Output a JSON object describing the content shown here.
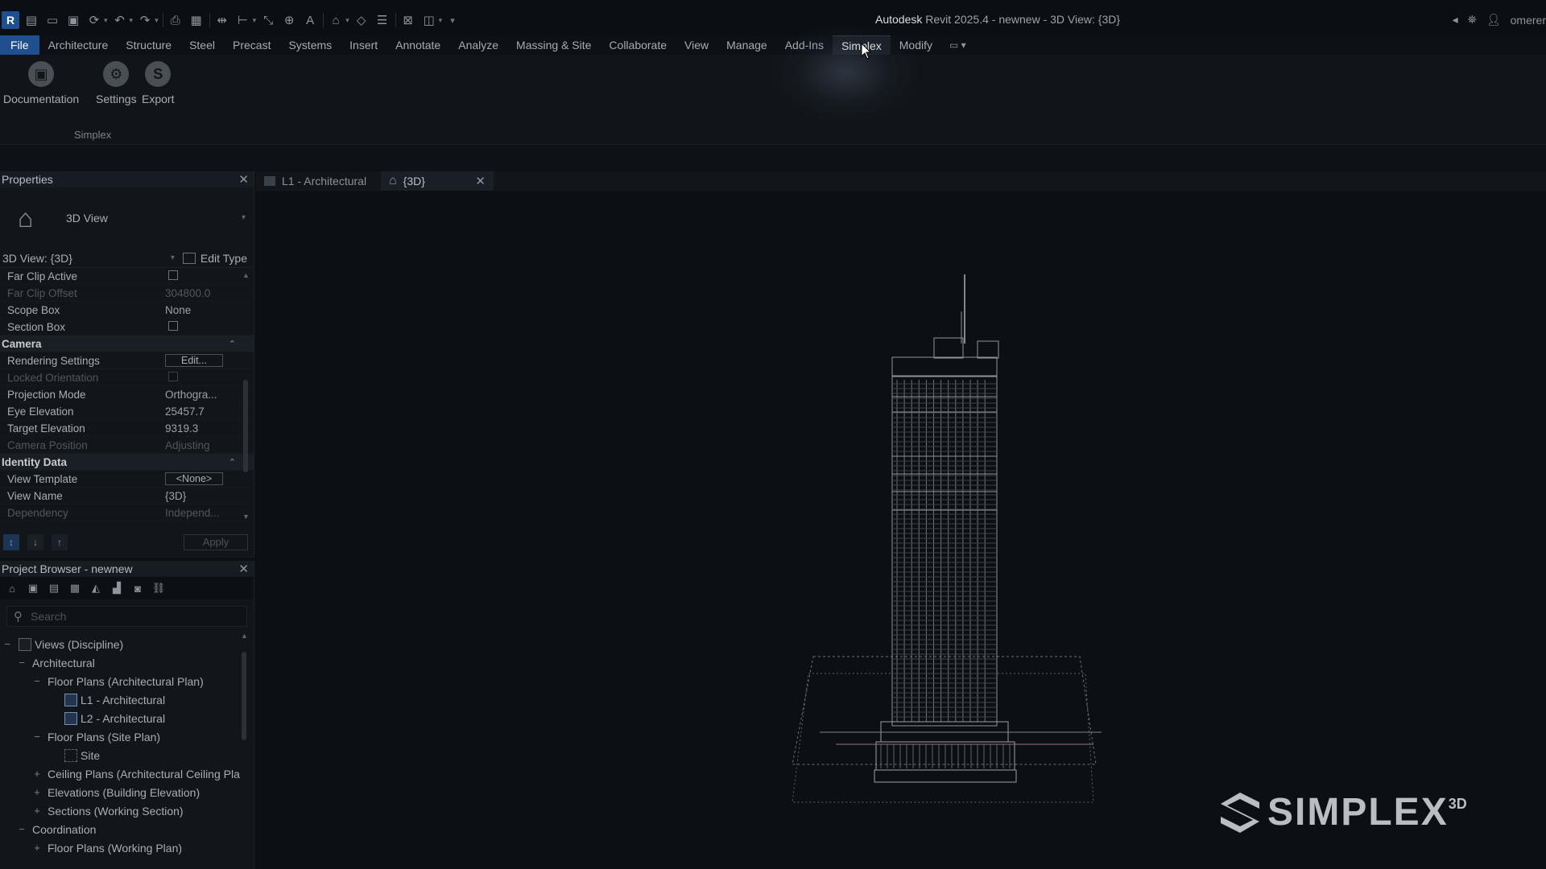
{
  "app": {
    "title_app": "Autodesk",
    "title_rest": " Revit 2025.4 - newnew - 3D View: {3D}",
    "logo_letter": "R",
    "user_name": "omerer"
  },
  "ribbon_tabs": [
    "File",
    "Architecture",
    "Structure",
    "Steel",
    "Precast",
    "Systems",
    "Insert",
    "Annotate",
    "Analyze",
    "Massing & Site",
    "Collaborate",
    "View",
    "Manage",
    "Add-Ins",
    "Simplex",
    "Modify"
  ],
  "ribbon": {
    "buttons": [
      {
        "label": "Documentation"
      },
      {
        "label": "Settings"
      },
      {
        "label": "Export"
      }
    ],
    "panel_name": "Simplex"
  },
  "properties": {
    "title": "Properties",
    "type_name": "3D View",
    "instance": "3D View: {3D}",
    "edit_type": "Edit Type",
    "rows": {
      "far_clip_active": "Far Clip Active",
      "far_clip_offset": "Far Clip Offset",
      "far_clip_offset_val": "304800.0",
      "scope_box": "Scope Box",
      "scope_box_val": "None",
      "section_box": "Section Box",
      "camera": "Camera",
      "rendering_settings": "Rendering Settings",
      "rendering_settings_btn": "Edit...",
      "locked_orientation": "Locked Orientation",
      "projection_mode": "Projection Mode",
      "projection_mode_val": "Orthogra...",
      "eye_elevation": "Eye Elevation",
      "eye_elevation_val": "25457.7",
      "target_elevation": "Target Elevation",
      "target_elevation_val": "9319.3",
      "camera_position": "Camera Position",
      "camera_position_val": "Adjusting",
      "identity_data": "Identity Data",
      "view_template": "View Template",
      "view_template_btn": "<None>",
      "view_name": "View Name",
      "view_name_val": "{3D}",
      "dependency": "Dependency",
      "dependency_val": "Independ..."
    },
    "apply": "Apply"
  },
  "project_browser": {
    "title": "Project Browser - newnew",
    "search_placeholder": "Search",
    "tree": {
      "views": "Views (Discipline)",
      "architectural": "Architectural",
      "floor_plans_arch": "Floor Plans (Architectural Plan)",
      "l1": "L1 - Architectural",
      "l2": "L2 - Architectural",
      "floor_plans_site": "Floor Plans (Site Plan)",
      "site": "Site",
      "ceiling_plans": "Ceiling Plans (Architectural Ceiling Pla",
      "elevations": "Elevations (Building Elevation)",
      "sections": "Sections (Working Section)",
      "coordination": "Coordination",
      "floor_plans_working": "Floor Plans (Working Plan)"
    }
  },
  "view_tabs": [
    {
      "label": "L1 - Architectural"
    },
    {
      "label": "{3D}"
    }
  ],
  "watermark": {
    "text": "SIMPLEX",
    "superscript": "3D"
  }
}
